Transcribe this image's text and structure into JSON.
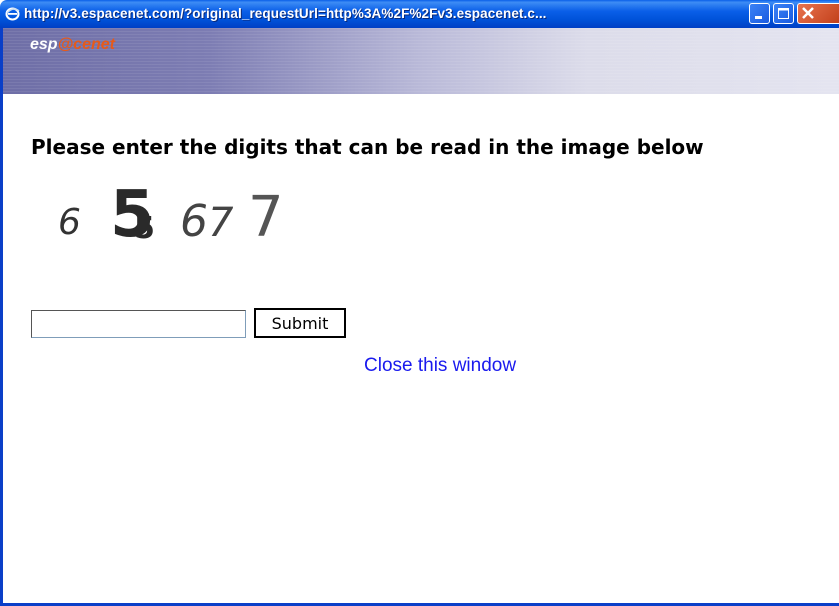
{
  "window": {
    "title": "http://v3.espacenet.com/?original_requestUrl=http%3A%2F%2Fv3.espacenet.c...",
    "minimize_label": "minimize",
    "maximize_label": "maximize",
    "close_label": "close"
  },
  "header": {
    "logo_text_start": "esp",
    "logo_text_mid": "@ce",
    "logo_text_end": "net"
  },
  "main": {
    "heading": "Please enter the digits that can be read in the image below",
    "captcha_digits": [
      "6",
      "5",
      "5",
      "6",
      "7",
      "7"
    ],
    "answer_value": "",
    "submit_label": "Submit",
    "close_link_label": "Close this window"
  },
  "colors": {
    "title_bar": "#0a5fe8",
    "link": "#1a1aee",
    "logo_accent": "#e65a1a"
  }
}
